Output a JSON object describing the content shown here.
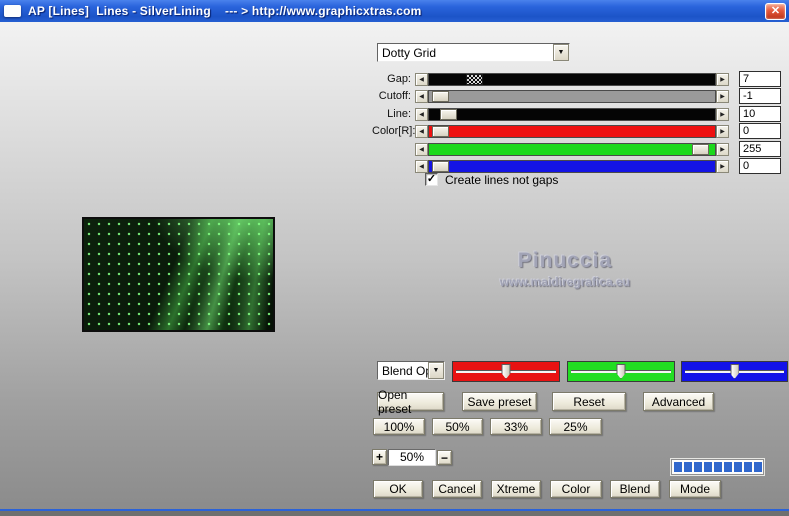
{
  "titlebar": {
    "title": "AP [Lines]  Lines - SilverLining    --- > http://www.graphicxtras.com",
    "close_glyph": "✕"
  },
  "icons": {
    "dropdown_arrow": "▼",
    "left_arrow": "◀",
    "right_arrow": "▶",
    "check": "✓"
  },
  "filter": {
    "preset_dropdown_value": "Dotty Grid",
    "sliders": [
      {
        "label": "Gap:",
        "value": "7",
        "track_color": "#050505",
        "thumb_left": "13%"
      },
      {
        "label": "Cutoff:",
        "value": "-1",
        "track_color": "#9a9a9a",
        "thumb_left": "1%"
      },
      {
        "label": "Line:",
        "value": "10",
        "track_color": "#050505",
        "thumb_left": "4%"
      },
      {
        "label": "Color[R]:",
        "value": "0",
        "track_color": "#ee1010",
        "thumb_left": "1%"
      },
      {
        "label": "",
        "value": "255",
        "track_color": "#1cd81c",
        "thumb_left": "92%"
      },
      {
        "label": "",
        "value": "0",
        "track_color": "#1414e4",
        "thumb_left": "1%"
      }
    ],
    "create_lines_checkbox": {
      "label": "Create lines not gaps",
      "checked": true
    }
  },
  "watermark": {
    "name": "Pinuccia",
    "url": "www.maidiregrafica.eu"
  },
  "blend": {
    "dropdown_value": "Blend Opti",
    "channel_sliders": [
      {
        "name": "red",
        "color": "#e81212"
      },
      {
        "name": "green",
        "color": "#22dd22"
      },
      {
        "name": "blue",
        "color": "#1212e8"
      }
    ]
  },
  "preset_buttons": {
    "open": "Open preset",
    "save": "Save preset",
    "reset": "Reset",
    "advanced": "Advanced"
  },
  "zoom": {
    "buttons": [
      "100%",
      "50%",
      "33%",
      "25%"
    ],
    "plus": "+",
    "minus": "−",
    "value": "50%"
  },
  "progress": {
    "segment_count": 9
  },
  "actions": {
    "ok": "OK",
    "cancel": "Cancel",
    "xtreme": "Xtreme",
    "color": "Color",
    "blend": "Blend",
    "mode": "Mode"
  }
}
